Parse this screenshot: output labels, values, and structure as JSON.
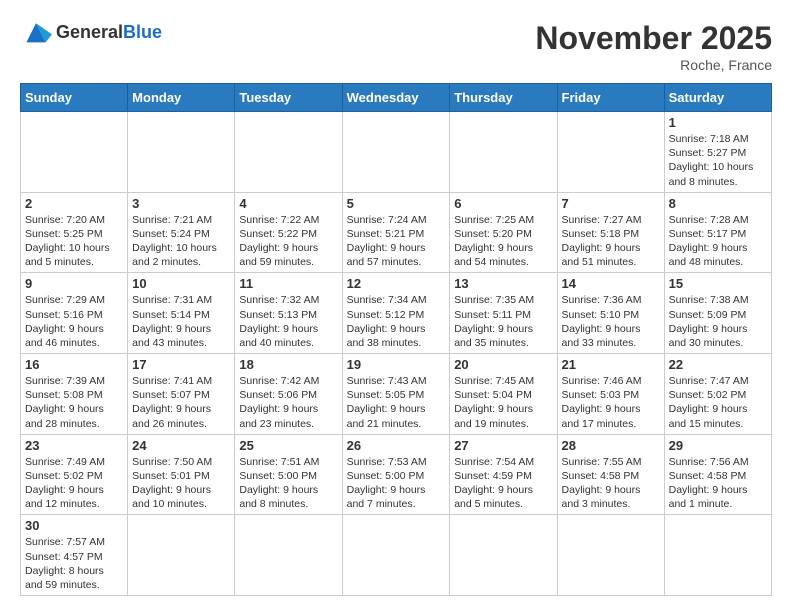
{
  "header": {
    "logo_general": "General",
    "logo_blue": "Blue",
    "month_year": "November 2025",
    "location": "Roche, France"
  },
  "days_header": [
    "Sunday",
    "Monday",
    "Tuesday",
    "Wednesday",
    "Thursday",
    "Friday",
    "Saturday"
  ],
  "weeks": [
    [
      {
        "day": "",
        "info": ""
      },
      {
        "day": "",
        "info": ""
      },
      {
        "day": "",
        "info": ""
      },
      {
        "day": "",
        "info": ""
      },
      {
        "day": "",
        "info": ""
      },
      {
        "day": "",
        "info": ""
      },
      {
        "day": "1",
        "info": "Sunrise: 7:18 AM\nSunset: 5:27 PM\nDaylight: 10 hours\nand 8 minutes."
      }
    ],
    [
      {
        "day": "2",
        "info": "Sunrise: 7:20 AM\nSunset: 5:25 PM\nDaylight: 10 hours\nand 5 minutes."
      },
      {
        "day": "3",
        "info": "Sunrise: 7:21 AM\nSunset: 5:24 PM\nDaylight: 10 hours\nand 2 minutes."
      },
      {
        "day": "4",
        "info": "Sunrise: 7:22 AM\nSunset: 5:22 PM\nDaylight: 9 hours\nand 59 minutes."
      },
      {
        "day": "5",
        "info": "Sunrise: 7:24 AM\nSunset: 5:21 PM\nDaylight: 9 hours\nand 57 minutes."
      },
      {
        "day": "6",
        "info": "Sunrise: 7:25 AM\nSunset: 5:20 PM\nDaylight: 9 hours\nand 54 minutes."
      },
      {
        "day": "7",
        "info": "Sunrise: 7:27 AM\nSunset: 5:18 PM\nDaylight: 9 hours\nand 51 minutes."
      },
      {
        "day": "8",
        "info": "Sunrise: 7:28 AM\nSunset: 5:17 PM\nDaylight: 9 hours\nand 48 minutes."
      }
    ],
    [
      {
        "day": "9",
        "info": "Sunrise: 7:29 AM\nSunset: 5:16 PM\nDaylight: 9 hours\nand 46 minutes."
      },
      {
        "day": "10",
        "info": "Sunrise: 7:31 AM\nSunset: 5:14 PM\nDaylight: 9 hours\nand 43 minutes."
      },
      {
        "day": "11",
        "info": "Sunrise: 7:32 AM\nSunset: 5:13 PM\nDaylight: 9 hours\nand 40 minutes."
      },
      {
        "day": "12",
        "info": "Sunrise: 7:34 AM\nSunset: 5:12 PM\nDaylight: 9 hours\nand 38 minutes."
      },
      {
        "day": "13",
        "info": "Sunrise: 7:35 AM\nSunset: 5:11 PM\nDaylight: 9 hours\nand 35 minutes."
      },
      {
        "day": "14",
        "info": "Sunrise: 7:36 AM\nSunset: 5:10 PM\nDaylight: 9 hours\nand 33 minutes."
      },
      {
        "day": "15",
        "info": "Sunrise: 7:38 AM\nSunset: 5:09 PM\nDaylight: 9 hours\nand 30 minutes."
      }
    ],
    [
      {
        "day": "16",
        "info": "Sunrise: 7:39 AM\nSunset: 5:08 PM\nDaylight: 9 hours\nand 28 minutes."
      },
      {
        "day": "17",
        "info": "Sunrise: 7:41 AM\nSunset: 5:07 PM\nDaylight: 9 hours\nand 26 minutes."
      },
      {
        "day": "18",
        "info": "Sunrise: 7:42 AM\nSunset: 5:06 PM\nDaylight: 9 hours\nand 23 minutes."
      },
      {
        "day": "19",
        "info": "Sunrise: 7:43 AM\nSunset: 5:05 PM\nDaylight: 9 hours\nand 21 minutes."
      },
      {
        "day": "20",
        "info": "Sunrise: 7:45 AM\nSunset: 5:04 PM\nDaylight: 9 hours\nand 19 minutes."
      },
      {
        "day": "21",
        "info": "Sunrise: 7:46 AM\nSunset: 5:03 PM\nDaylight: 9 hours\nand 17 minutes."
      },
      {
        "day": "22",
        "info": "Sunrise: 7:47 AM\nSunset: 5:02 PM\nDaylight: 9 hours\nand 15 minutes."
      }
    ],
    [
      {
        "day": "23",
        "info": "Sunrise: 7:49 AM\nSunset: 5:02 PM\nDaylight: 9 hours\nand 12 minutes."
      },
      {
        "day": "24",
        "info": "Sunrise: 7:50 AM\nSunset: 5:01 PM\nDaylight: 9 hours\nand 10 minutes."
      },
      {
        "day": "25",
        "info": "Sunrise: 7:51 AM\nSunset: 5:00 PM\nDaylight: 9 hours\nand 8 minutes."
      },
      {
        "day": "26",
        "info": "Sunrise: 7:53 AM\nSunset: 5:00 PM\nDaylight: 9 hours\nand 7 minutes."
      },
      {
        "day": "27",
        "info": "Sunrise: 7:54 AM\nSunset: 4:59 PM\nDaylight: 9 hours\nand 5 minutes."
      },
      {
        "day": "28",
        "info": "Sunrise: 7:55 AM\nSunset: 4:58 PM\nDaylight: 9 hours\nand 3 minutes."
      },
      {
        "day": "29",
        "info": "Sunrise: 7:56 AM\nSunset: 4:58 PM\nDaylight: 9 hours\nand 1 minute."
      }
    ],
    [
      {
        "day": "30",
        "info": "Sunrise: 7:57 AM\nSunset: 4:57 PM\nDaylight: 8 hours\nand 59 minutes."
      },
      {
        "day": "",
        "info": ""
      },
      {
        "day": "",
        "info": ""
      },
      {
        "day": "",
        "info": ""
      },
      {
        "day": "",
        "info": ""
      },
      {
        "day": "",
        "info": ""
      },
      {
        "day": "",
        "info": ""
      }
    ]
  ]
}
